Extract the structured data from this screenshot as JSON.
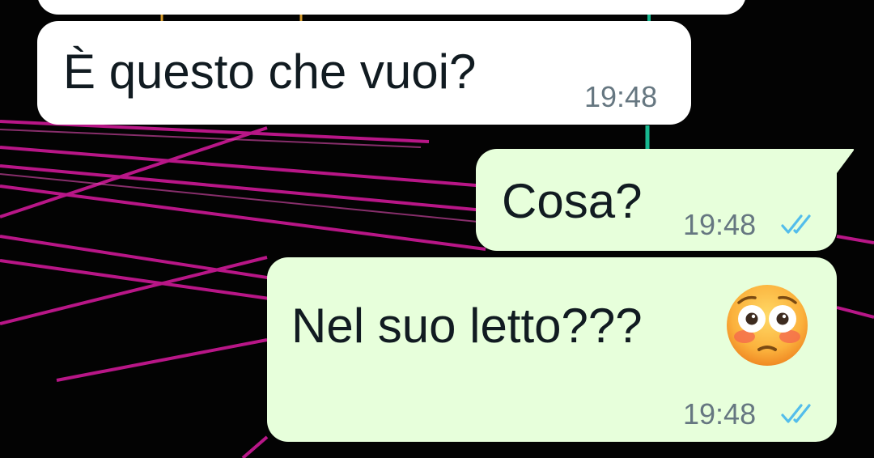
{
  "colors": {
    "incoming_bubble": "#ffffff",
    "outgoing_bubble": "#e7ffdb",
    "text": "#111b21",
    "timestamp": "#667781",
    "read_ticks": "#53bdeb",
    "grid_lines": "#c2188f",
    "wallpaper": "#030303"
  },
  "messages": [
    {
      "direction": "incoming",
      "text": "È questo che vuoi?",
      "time": "19:48"
    },
    {
      "direction": "outgoing",
      "text": "Cosa?",
      "time": "19:48",
      "status_icon": "double-check-read-icon"
    },
    {
      "direction": "outgoing",
      "text": "Nel suo letto???",
      "emoji": "flushed-face-emoji",
      "time": "19:48",
      "status_icon": "double-check-read-icon"
    }
  ]
}
